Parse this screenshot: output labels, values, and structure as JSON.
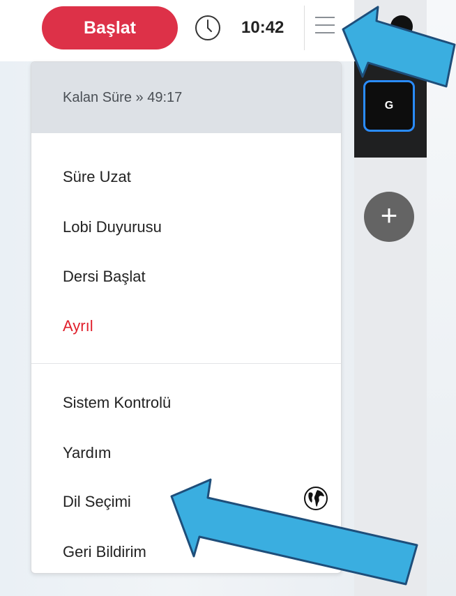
{
  "toolbar": {
    "start_label": "Başlat",
    "time": "10:42"
  },
  "menu": {
    "header": "Kalan Süre » 49:17",
    "items": [
      {
        "label": "Süre Uzat"
      },
      {
        "label": "Lobi Duyurusu"
      },
      {
        "label": "Dersi Başlat"
      },
      {
        "label": "Ayrıl"
      }
    ],
    "items2": [
      {
        "label": "Sistem Kontrolü"
      },
      {
        "label": "Yardım"
      },
      {
        "label": "Dil Seçimi",
        "icon": "globe-icon"
      },
      {
        "label": "Geri Bildirim",
        "icon": "feedback-icon"
      }
    ]
  },
  "side": {
    "tile_letter": "G",
    "add_icon": "plus-icon"
  },
  "colors": {
    "start_button": "#dd3148",
    "danger_text": "#e0202c",
    "tile_border": "#2a8cff",
    "annotation_arrow": "#3aaee0"
  }
}
